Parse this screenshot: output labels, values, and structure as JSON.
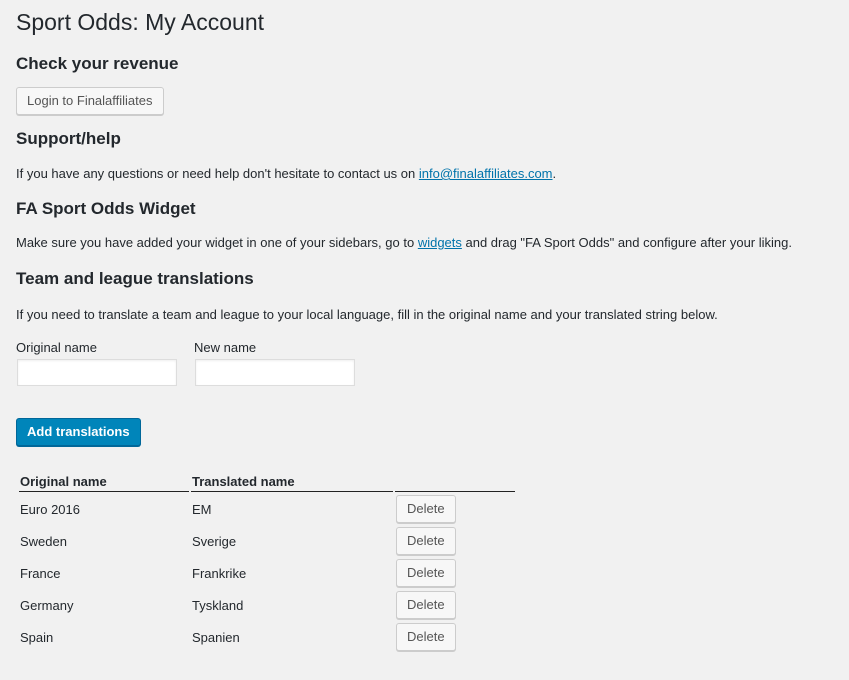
{
  "page": {
    "title": "Sport Odds: My Account"
  },
  "revenue": {
    "heading": "Check your revenue",
    "login_button": "Login to Finalaffiliates"
  },
  "support": {
    "heading": "Support/help",
    "text_before": "If you have any questions or need help don't hesitate to contact us on ",
    "email": "info@finalaffiliates.com",
    "text_after": "."
  },
  "widget": {
    "heading": "FA Sport Odds Widget",
    "text_before": "Make sure you have added your widget in one of your sidebars, go to ",
    "link": "widgets",
    "text_after": " and drag \"FA Sport Odds\" and configure after your liking."
  },
  "translations": {
    "heading": "Team and league translations",
    "description": "If you need to translate a team and league to your local language, fill in the original name and your translated string below.",
    "original_label": "Original name",
    "new_label": "New name",
    "original_value": "",
    "new_value": "",
    "add_button": "Add translations",
    "table": {
      "headers": [
        "Original name",
        "Translated name",
        ""
      ],
      "delete_label": "Delete",
      "rows": [
        {
          "original": "Euro 2016",
          "translated": "EM"
        },
        {
          "original": "Sweden",
          "translated": "Sverige"
        },
        {
          "original": "France",
          "translated": "Frankrike"
        },
        {
          "original": "Germany",
          "translated": "Tyskland"
        },
        {
          "original": "Spain",
          "translated": "Spanien"
        }
      ]
    }
  },
  "colors": {
    "background": "#f1f1f1",
    "primary_button": "#0085ba",
    "link": "#0073aa"
  }
}
